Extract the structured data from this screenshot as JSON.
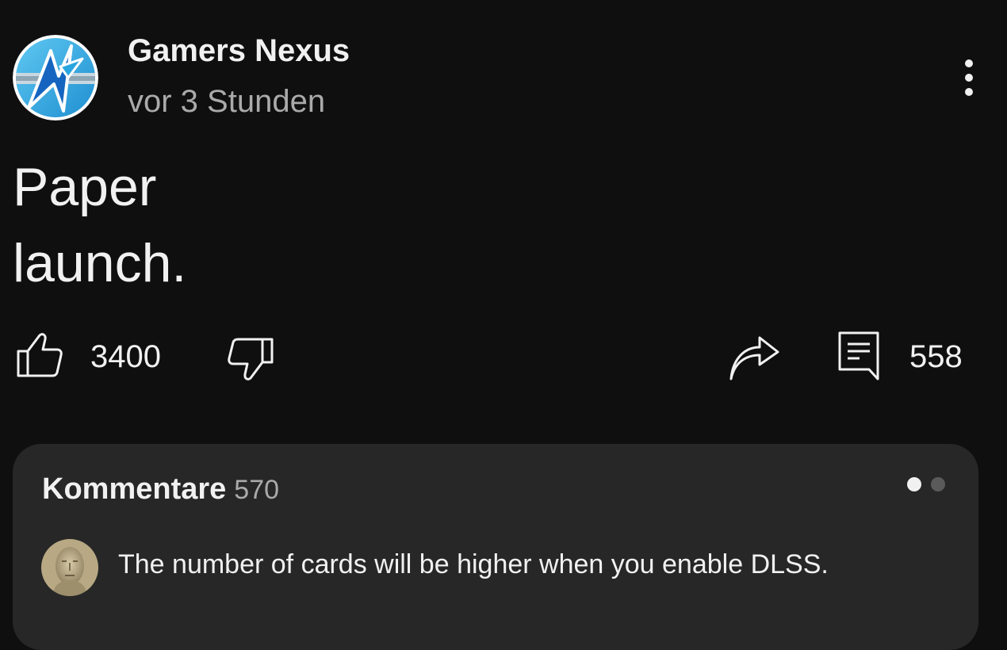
{
  "post": {
    "channel_name": "Gamers Nexus",
    "time": "vor 3 Stunden",
    "text_line1": "Paper",
    "text_line2": "launch.",
    "like_count": "3400",
    "comment_count": "558"
  },
  "comments": {
    "title": "Kommentare",
    "count": "570",
    "top_comment": "The number of cards will be higher when you enable DLSS.",
    "carousel_pages": 2,
    "carousel_active": 1
  },
  "icons": {
    "avatar": "gamers-nexus-logo",
    "more": "vertical-dots-icon",
    "like": "thumbs-up-icon",
    "dislike": "thumbs-down-icon",
    "share": "share-arrow-icon",
    "comment": "comment-icon"
  },
  "colors": {
    "background": "#0f0f0f",
    "card": "#272727",
    "text_primary": "#f1f1f1",
    "text_secondary": "#aaaaaa"
  }
}
